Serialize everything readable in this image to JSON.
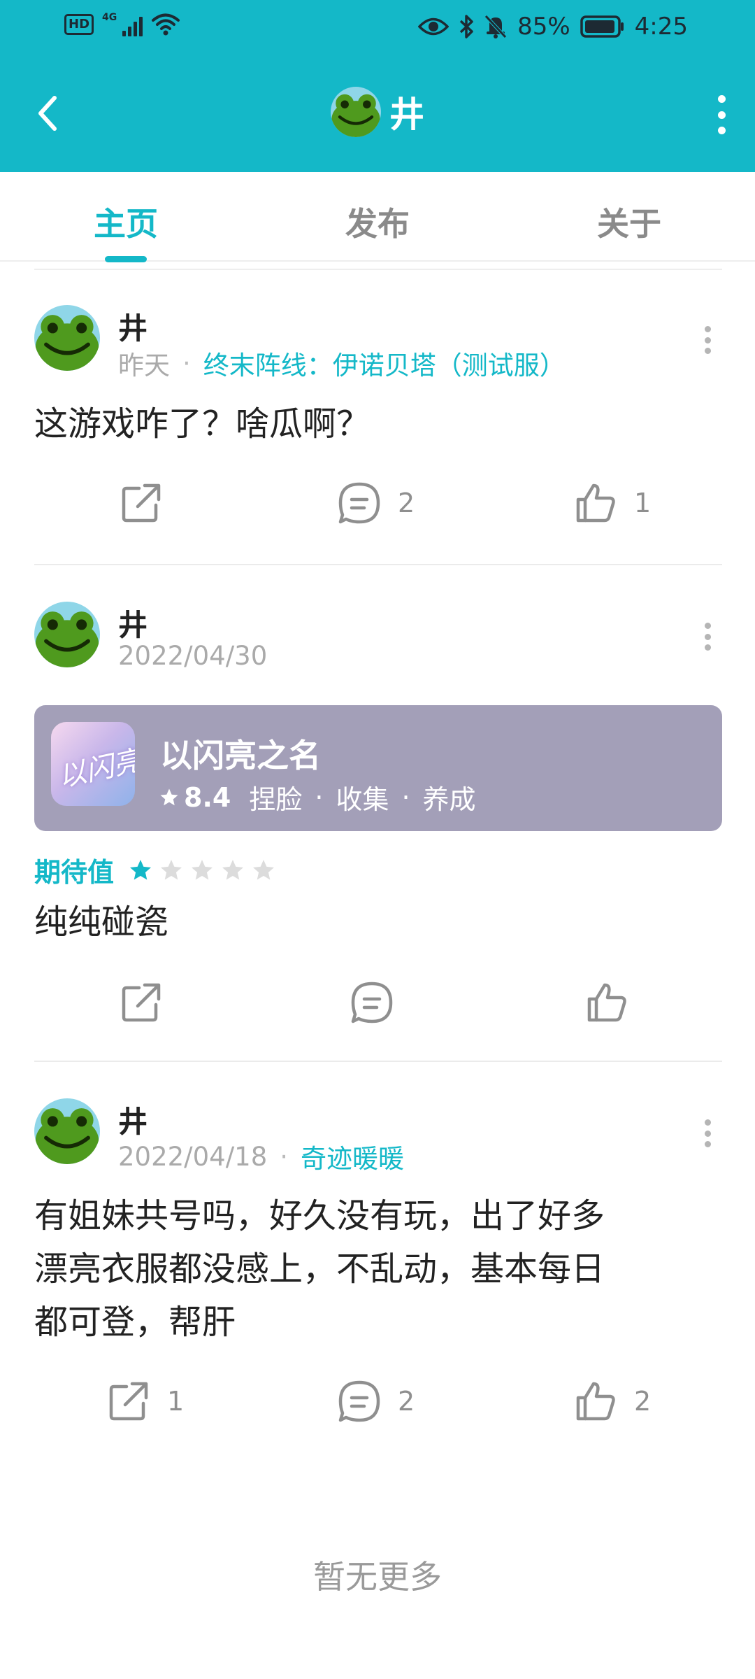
{
  "status_bar": {
    "hd": "HD",
    "network": "4G",
    "battery_percent": "85%",
    "time": "4:25",
    "icons": [
      "eye-icon",
      "bluetooth-icon",
      "mute-bell-icon",
      "battery-icon",
      "wifi-icon",
      "signal-icon"
    ]
  },
  "header": {
    "title": "井",
    "back_icon": "chevron-left-icon",
    "menu_icon": "vertical-dots-icon"
  },
  "tabs": [
    {
      "label": "主页",
      "active": true
    },
    {
      "label": "发布",
      "active": false
    },
    {
      "label": "关于",
      "active": false
    }
  ],
  "posts": [
    {
      "username": "井",
      "time": "昨天",
      "game": "终末阵线：伊诺贝塔（测试服）",
      "content": "这游戏咋了？啥瓜啊？",
      "share_count": "",
      "comment_count": "2",
      "like_count": "1"
    },
    {
      "username": "井",
      "time": "2022/04/30",
      "game_card": {
        "name": "以闪亮之名",
        "rating": "8.4",
        "tags": [
          "捏脸",
          "收集",
          "养成"
        ],
        "icon_text": "以闪亮之名"
      },
      "expectation_label": "期待值",
      "expectation_stars": 1,
      "content": "纯纯碰瓷",
      "share_count": "",
      "comment_count": "",
      "like_count": ""
    },
    {
      "username": "井",
      "time": "2022/04/18",
      "game": "奇迹暖暖",
      "content_lines": [
        "有姐妹共号吗，好久没有玩，出了好多",
        "漂亮衣服都没感上，不乱动，基本每日",
        "都可登，帮肝"
      ],
      "share_count": "1",
      "comment_count": "2",
      "like_count": "2"
    }
  ],
  "footer": {
    "no_more": "暂无更多"
  },
  "colors": {
    "accent": "#14b8c8",
    "card_bg": "#a39fb8",
    "muted": "#aaaaaa"
  }
}
